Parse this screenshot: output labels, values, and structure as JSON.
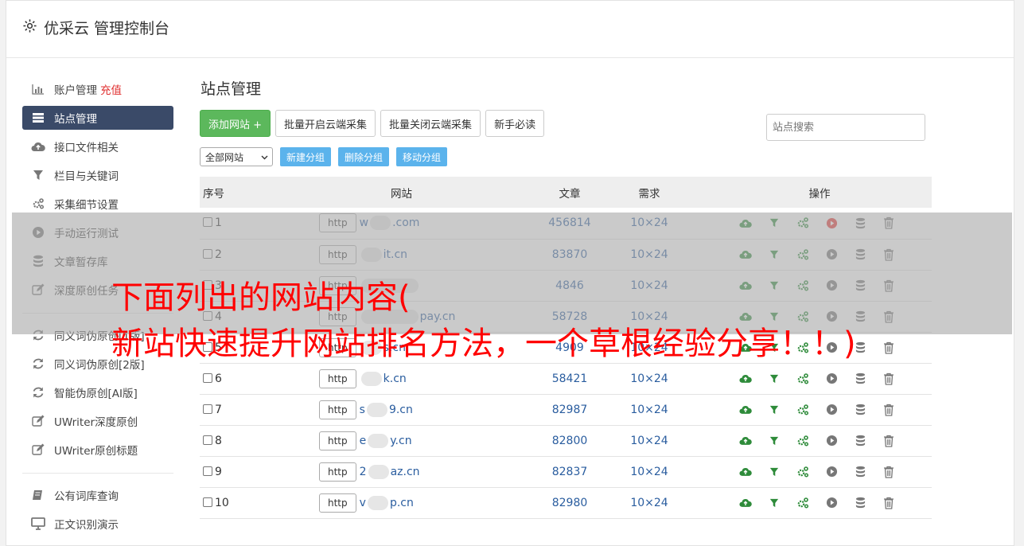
{
  "app": {
    "title": "优采云 管理控制台"
  },
  "sidebar": {
    "group1": [
      {
        "label": "账户管理",
        "extra": "充值",
        "icon": "bar-chart-icon"
      },
      {
        "label": "站点管理",
        "icon": "server-list-icon",
        "active": true
      },
      {
        "label": "接口文件相关",
        "icon": "cloud-upload-icon"
      },
      {
        "label": "栏目与关键词",
        "icon": "filter-icon"
      },
      {
        "label": "采集细节设置",
        "icon": "gears-icon"
      },
      {
        "label": "手动运行测试",
        "icon": "play-icon"
      },
      {
        "label": "文章暂存库",
        "icon": "database-icon"
      },
      {
        "label": "深度原创任务",
        "icon": "edit-icon"
      }
    ],
    "group2": [
      {
        "label": "同义词伪原创[1版]",
        "icon": "refresh-icon"
      },
      {
        "label": "同义词伪原创[2版]",
        "icon": "refresh-icon"
      },
      {
        "label": "智能伪原创[AI版]",
        "icon": "refresh-icon"
      },
      {
        "label": "UWriter深度原创",
        "icon": "edit-icon"
      },
      {
        "label": "UWriter原创标题",
        "icon": "edit-icon"
      }
    ],
    "group3": [
      {
        "label": "公有词库查询",
        "icon": "book-icon"
      },
      {
        "label": "正文识别演示",
        "icon": "monitor-icon"
      }
    ]
  },
  "main": {
    "title": "站点管理",
    "buttons": {
      "add": "添加网站 +",
      "batch_open": "批量开启云端采集",
      "batch_close": "批量关闭云端采集",
      "guide": "新手必读"
    },
    "search_placeholder": "站点搜索",
    "group_select": "全部网站",
    "group_buttons": {
      "new": "新建分组",
      "delete": "删除分组",
      "move": "移动分组"
    },
    "table": {
      "headers": {
        "no": "序号",
        "site": "网站",
        "articles": "文章",
        "demand": "需求",
        "ops": "操作"
      },
      "protocol_label": "http",
      "rows": [
        {
          "no": "1",
          "prefix": "w",
          "suffix": ".com",
          "articles": "456814",
          "demand": "10×24",
          "running": true
        },
        {
          "no": "2",
          "prefix": "",
          "suffix": "it.cn",
          "articles": "83870",
          "demand": "10×24",
          "running": false
        },
        {
          "no": "3",
          "prefix": "",
          "suffix": "",
          "articles": "4846",
          "demand": "10×24",
          "running": false
        },
        {
          "no": "4",
          "prefix": "",
          "suffix": "pay.cn",
          "articles": "58728",
          "demand": "10×24",
          "running": false
        },
        {
          "no": "5",
          "prefix": "",
          "suffix": "s.cn",
          "articles": "4909",
          "demand": "10×24",
          "running": false
        },
        {
          "no": "6",
          "prefix": "",
          "suffix": "k.cn",
          "articles": "58421",
          "demand": "10×24",
          "running": false
        },
        {
          "no": "7",
          "prefix": "s",
          "suffix": "9.cn",
          "articles": "82987",
          "demand": "10×24",
          "running": false
        },
        {
          "no": "8",
          "prefix": "e",
          "suffix": "y.cn",
          "articles": "82800",
          "demand": "10×24",
          "running": false
        },
        {
          "no": "9",
          "prefix": "2",
          "suffix": "az.cn",
          "articles": "82837",
          "demand": "10×24",
          "running": false
        },
        {
          "no": "10",
          "prefix": "v",
          "suffix": "p.cn",
          "articles": "82980",
          "demand": "10×24",
          "running": false
        }
      ]
    }
  },
  "overlay": {
    "line1": "下面列出的网站内容(",
    "line2": "新站快速提升网站排名方法，一个草根经验分享！！)"
  },
  "colors": {
    "sidebar_active": "#3a4a68",
    "add_button": "#5cb85c",
    "small_button": "#5bb3ec",
    "overlay_text": "#ff0000",
    "link": "#2a5d9f"
  }
}
